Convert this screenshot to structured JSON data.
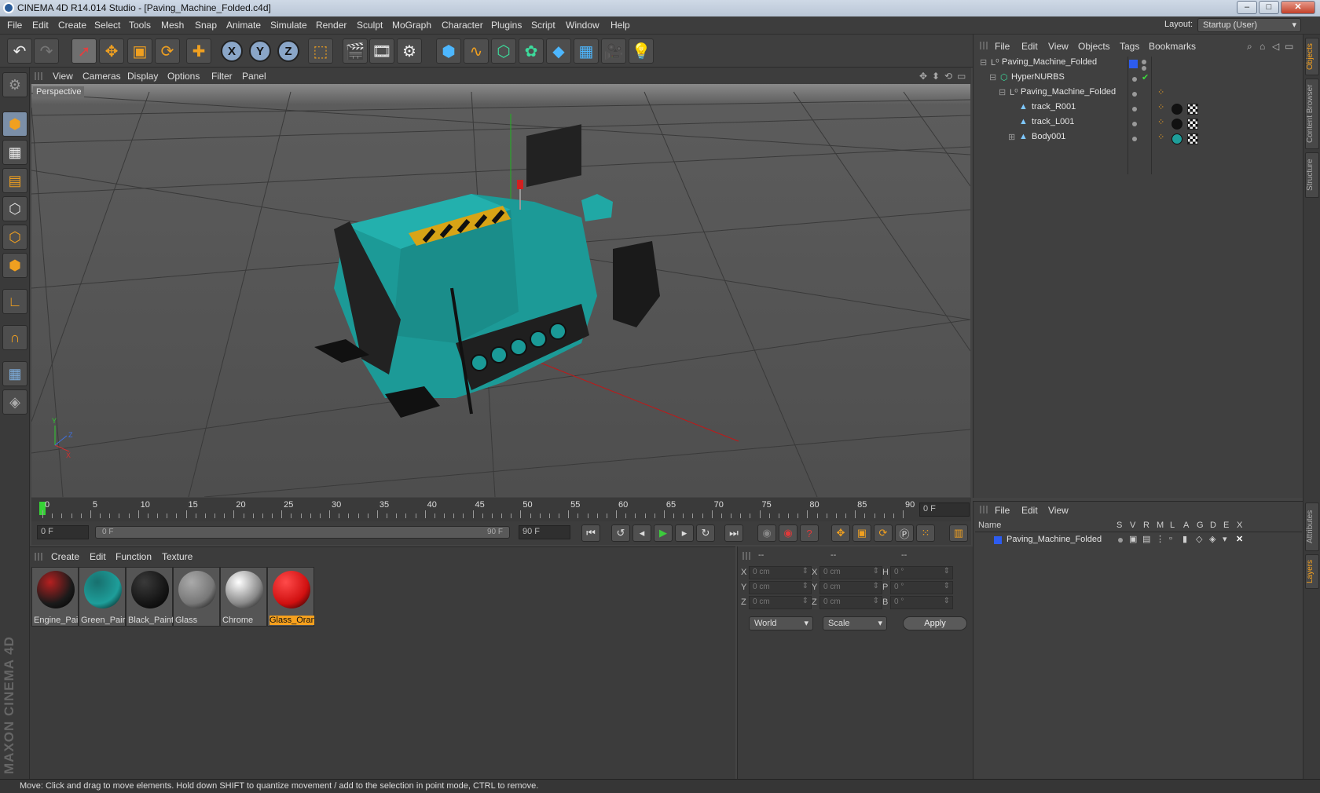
{
  "window": {
    "title": "CINEMA 4D R14.014 Studio - [Paving_Machine_Folded.c4d]",
    "minimize": "–",
    "maximize": "□",
    "close": "✕"
  },
  "menubar": {
    "items": [
      "File",
      "Edit",
      "Create",
      "Select",
      "Tools",
      "Mesh",
      "Snap",
      "Animate",
      "Simulate",
      "Render",
      "Sculpt",
      "MoGraph",
      "Character",
      "Plugins",
      "Script",
      "Window",
      "Help"
    ],
    "layout_label": "Layout:",
    "layout_value": "Startup (User)"
  },
  "toolbar": {
    "axis_x": "X",
    "axis_y": "Y",
    "axis_z": "Z"
  },
  "viewport": {
    "menu": [
      "View",
      "Cameras",
      "Display",
      "Options",
      "Filter",
      "Panel"
    ],
    "label": "Perspective",
    "axis_x": "X",
    "axis_y": "Y",
    "axis_z": "Z"
  },
  "timeline": {
    "ticks": [
      "0",
      "5",
      "10",
      "15",
      "20",
      "25",
      "30",
      "35",
      "40",
      "45",
      "50",
      "55",
      "60",
      "65",
      "70",
      "75",
      "80",
      "85",
      "90"
    ],
    "current_frame": "0 F"
  },
  "transport": {
    "start_field": "0 F",
    "range_start": "0 F",
    "range_end": "90 F",
    "end_field": "90 F"
  },
  "material_manager": {
    "menu": [
      "Create",
      "Edit",
      "Function",
      "Texture"
    ],
    "materials": [
      {
        "label": "Engine_Pai",
        "color": "#1a1a1a",
        "accent": "#b52020"
      },
      {
        "label": "Green_Pair",
        "color": "#1e9e9a",
        "accent": "#18706e"
      },
      {
        "label": "Black_Paint",
        "color": "#151515",
        "accent": "#3a3a3a"
      },
      {
        "label": "Glass",
        "color": "#777777",
        "accent": "#aaaaaa"
      },
      {
        "label": "Chrome",
        "color": "#888888",
        "accent": "#ffffff"
      },
      {
        "label": "Glass_Oran",
        "color": "#d01010",
        "accent": "#ff4a4a"
      }
    ]
  },
  "coords": {
    "headers": [
      "--",
      "--",
      "--"
    ],
    "rows": [
      {
        "a": "X",
        "av": "0 cm",
        "b": "X",
        "bv": "0 cm",
        "c": "H",
        "cv": "0 °"
      },
      {
        "a": "Y",
        "av": "0 cm",
        "b": "Y",
        "bv": "0 cm",
        "c": "P",
        "cv": "0 °"
      },
      {
        "a": "Z",
        "av": "0 cm",
        "b": "Z",
        "bv": "0 cm",
        "c": "B",
        "cv": "0 °"
      }
    ],
    "mode": "World",
    "scale": "Scale",
    "apply": "Apply"
  },
  "object_manager": {
    "menu": [
      "File",
      "Edit",
      "View",
      "Objects",
      "Tags",
      "Bookmarks"
    ],
    "objects": [
      {
        "name": "Paving_Machine_Folded"
      },
      {
        "name": "HyperNURBS"
      },
      {
        "name": "Paving_Machine_Folded"
      },
      {
        "name": "track_R001"
      },
      {
        "name": "track_L001"
      },
      {
        "name": "Body001"
      }
    ]
  },
  "layer_manager": {
    "menu": [
      "File",
      "Edit",
      "View"
    ],
    "columns": [
      "Name",
      "S",
      "V",
      "R",
      "M",
      "L",
      "A",
      "G",
      "D",
      "E",
      "X"
    ],
    "layer_name": "Paving_Machine_Folded"
  },
  "side_tabs": [
    "Objects",
    "Content Browser",
    "Structure",
    "Attributes",
    "Layers"
  ],
  "branding": "MAXON CINEMA 4D",
  "status": "Move: Click and drag to move elements. Hold down SHIFT to quantize movement / add to the selection in point mode, CTRL to remove."
}
